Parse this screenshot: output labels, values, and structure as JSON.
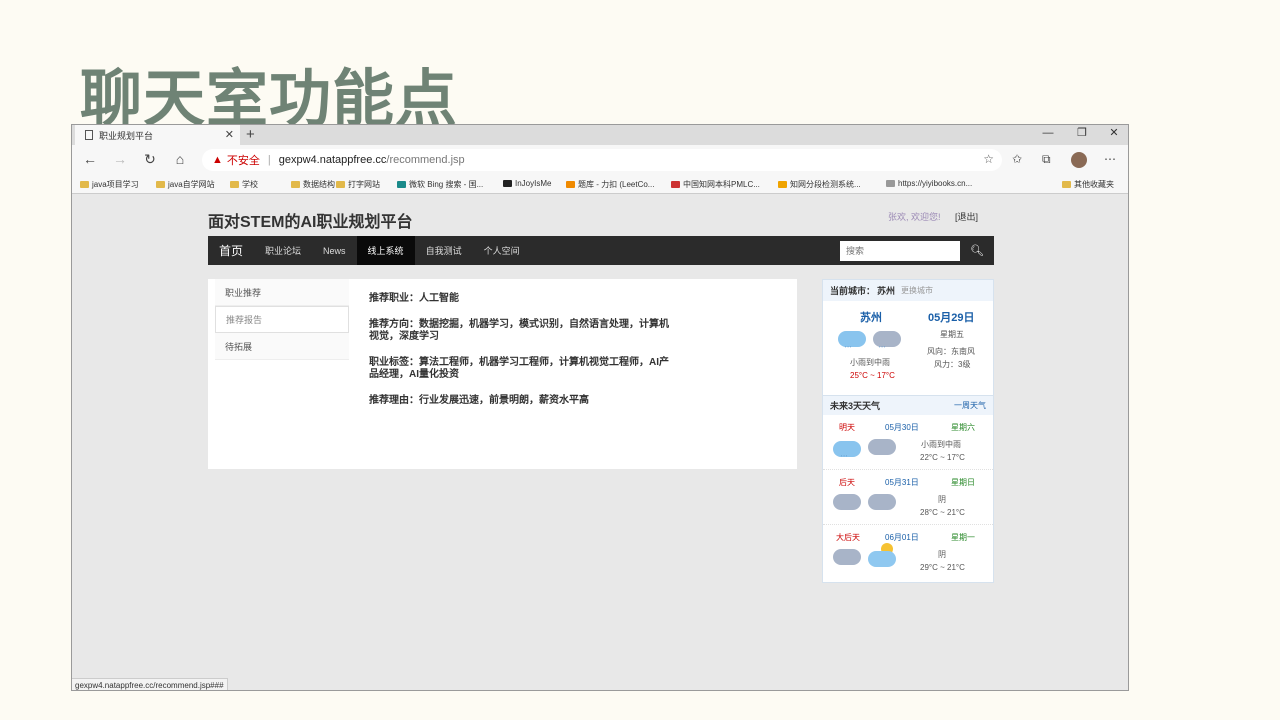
{
  "slide_title": "聊天室功能点",
  "browser": {
    "tab_title": "职业规划平台",
    "new_tab": "+",
    "window_controls": [
      "—",
      "❐",
      "✕"
    ],
    "security_label": "不安全",
    "url_host": "gexpw4.natappfree.cc",
    "url_path": "/recommend.jsp",
    "bookmarks": [
      {
        "label": "java项目学习",
        "icon": "folder-icon"
      },
      {
        "label": "java自学网站",
        "icon": "folder-icon"
      },
      {
        "label": "学校",
        "icon": "folder-icon"
      },
      {
        "label": "数据结构",
        "icon": "folder-icon"
      },
      {
        "label": "打字网站",
        "icon": "folder-icon"
      },
      {
        "label": "微软 Bing 搜索 - 国...",
        "icon": "bing-icon"
      },
      {
        "label": "InJoyIsMe",
        "icon": "github-icon"
      },
      {
        "label": "题库 - 力扣 (LeetCo...",
        "icon": "leetcode-icon"
      },
      {
        "label": "中国知网本科PMLC...",
        "icon": "cnki-icon"
      },
      {
        "label": "知网分段检测系统...",
        "icon": "zw-icon"
      },
      {
        "label": "https://yiyibooks.cn...",
        "icon": "yiyi-icon"
      },
      {
        "label": "其他收藏夹",
        "icon": "folder-icon"
      }
    ],
    "status_url": "gexpw4.natappfree.cc/recommend.jsp###"
  },
  "site": {
    "title": "面对STEM的AI职业规划平台",
    "welcome": "张欢, 欢迎您!",
    "logout": "[退出]",
    "nav": [
      "首页",
      "职业论坛",
      "News",
      "线上系统",
      "自我测试",
      "个人空间"
    ],
    "active_nav": "线上系统",
    "search_placeholder": "搜索"
  },
  "side_menu": [
    "职业推荐",
    "推荐报告",
    "待拓展"
  ],
  "recommendation": {
    "career": "推荐职业：人工智能",
    "direction": "推荐方向：数据挖掘，机器学习，模式识别，自然语言处理，计算机视觉，深度学习",
    "tags": "职业标签：算法工程师，机器学习工程师，计算机视觉工程师，AI产品经理，AI量化投资",
    "reason": "推荐理由：行业发展迅速，前景明朗，薪资水平高"
  },
  "weather": {
    "header_label": "当前城市：",
    "city": "苏州",
    "change_city": "更换城市",
    "today": {
      "city": "苏州",
      "date": "05月29日",
      "weekday": "星期五",
      "desc": "小雨到中雨",
      "temp": "25°C ~ 17°C",
      "wind_dir": "风向：东南风",
      "wind_level": "风力：3级"
    },
    "forecast_title": "未来3天天气",
    "forecast_more": "一周天气",
    "forecast": [
      {
        "rel": "明天",
        "date": "05月30日",
        "weekday": "星期六",
        "desc": "小雨到中雨",
        "temp": "22°C ~ 17°C",
        "icons": [
          "rain-cloud-icon",
          "cloud-icon"
        ]
      },
      {
        "rel": "后天",
        "date": "05月31日",
        "weekday": "星期日",
        "desc": "阴",
        "temp": "28°C ~ 21°C",
        "icons": [
          "cloud-icon",
          "cloud-icon"
        ]
      },
      {
        "rel": "大后天",
        "date": "06月01日",
        "weekday": "星期一",
        "desc": "阴",
        "temp": "29°C ~ 21°C",
        "icons": [
          "cloud-icon",
          "sun-cloud-icon"
        ]
      }
    ]
  }
}
